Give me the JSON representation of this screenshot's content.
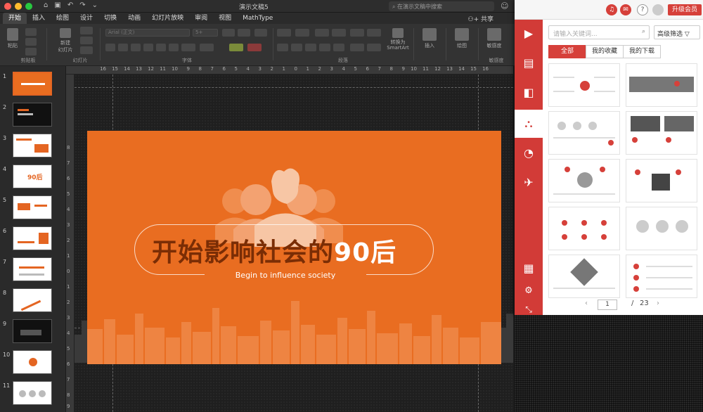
{
  "window": {
    "title": "演示文稿5",
    "search_placeholder": "在演示文稿中搜索"
  },
  "tabs": [
    "开始",
    "插入",
    "绘图",
    "设计",
    "切换",
    "动画",
    "幻灯片放映",
    "审阅",
    "视图",
    "MathType"
  ],
  "share_label": "共享",
  "ribbon": {
    "paste_label": "粘贴",
    "new_slide_label": "新建\n幻灯片",
    "convert_smartart_label": "转换为\nSmartArt",
    "insert_label": "插入",
    "draw_label": "绘图",
    "sensitivity_label": "敏感度",
    "font_name": "Arial (正文)",
    "font_size": "5+",
    "groups": [
      "剪贴板",
      "幻灯片",
      "字体",
      "段落",
      "敏感度"
    ]
  },
  "thumbnails": [
    "1",
    "2",
    "3",
    "4",
    "5",
    "6",
    "7",
    "8",
    "9",
    "10",
    "11"
  ],
  "thumbnail_8_text": "90后",
  "ruler_h": [
    "16",
    "15",
    "14",
    "13",
    "12",
    "11",
    "10",
    "9",
    "8",
    "7",
    "6",
    "5",
    "4",
    "3",
    "2",
    "1",
    "0",
    "1",
    "2",
    "3",
    "4",
    "5",
    "6",
    "7",
    "8",
    "9",
    "10",
    "11",
    "12",
    "13",
    "14",
    "15",
    "16"
  ],
  "ruler_v": [
    "8",
    "7",
    "6",
    "5",
    "4",
    "3",
    "2",
    "1",
    "0",
    "1",
    "2",
    "3",
    "4",
    "5",
    "6",
    "7",
    "8",
    "9"
  ],
  "slide": {
    "title_part1": "开始影响社会的",
    "title_part2": "90后",
    "subtitle": "Begin to influence society"
  },
  "panel": {
    "upgrade_label": "升级会员",
    "help_label": "?",
    "search_placeholder": "请输入关键词...",
    "advanced_filter_label": "高级筛选",
    "filter_tabs": [
      "全部",
      "我的收藏",
      "我的下载"
    ],
    "active_filter": "全部",
    "pager": {
      "current": "1",
      "separator": "/",
      "total": "23"
    },
    "accent_color": "#d23b37"
  }
}
